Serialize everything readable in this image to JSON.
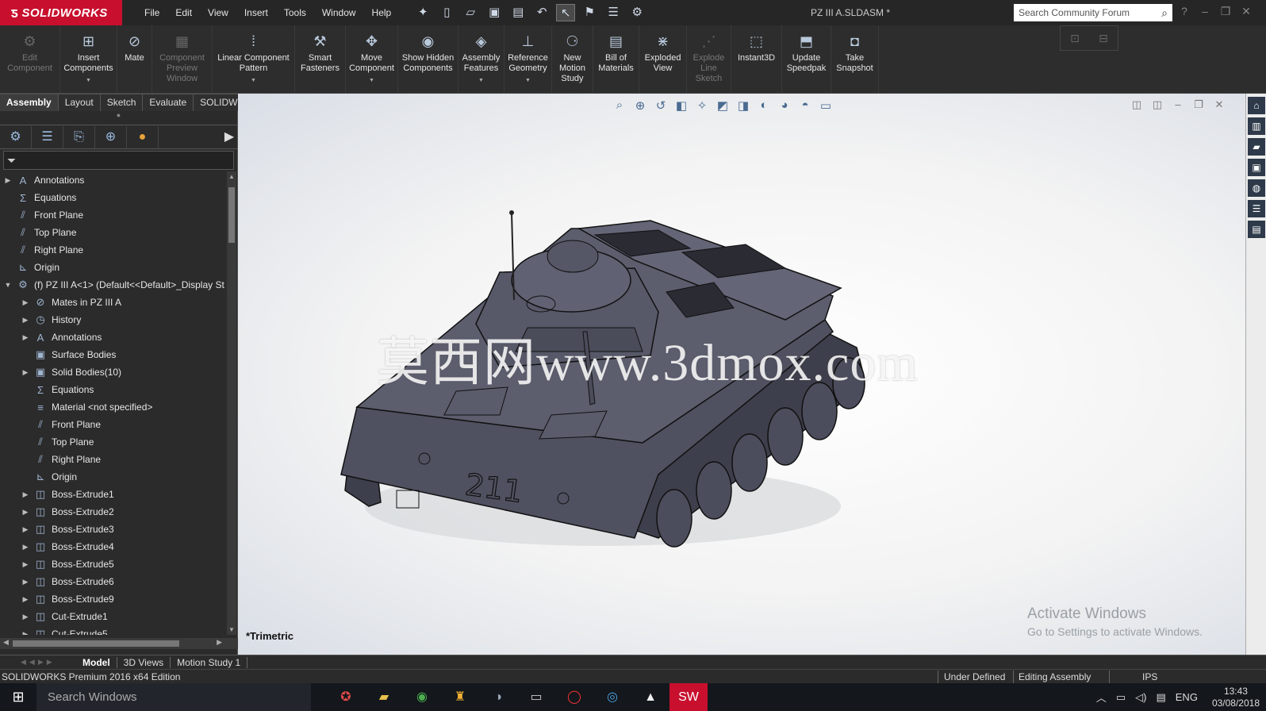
{
  "app": {
    "logo": "SOLIDWORKS",
    "doc_title": "PZ III A.SLDASM *",
    "menus": [
      "File",
      "Edit",
      "View",
      "Insert",
      "Tools",
      "Window",
      "Help"
    ],
    "search_placeholder": "Search Community Forum"
  },
  "commands": [
    {
      "label": "Edit Component",
      "icon": "edit-component-icon",
      "disabled": true
    },
    {
      "label": "Insert Components",
      "icon": "insert-components-icon",
      "disabled": false,
      "dropdown": true
    },
    {
      "label": "Mate",
      "icon": "mate-icon",
      "disabled": false
    },
    {
      "label": "Component Preview Window",
      "icon": "component-preview-icon",
      "disabled": true
    },
    {
      "label": "Linear Component Pattern",
      "icon": "linear-pattern-icon",
      "disabled": false,
      "dropdown": true
    },
    {
      "label": "Smart Fasteners",
      "icon": "smart-fasteners-icon",
      "disabled": false
    },
    {
      "label": "Move Component",
      "icon": "move-component-icon",
      "disabled": false,
      "dropdown": true
    },
    {
      "label": "Show Hidden Components",
      "icon": "show-hidden-icon",
      "disabled": false
    },
    {
      "label": "Assembly Features",
      "icon": "assembly-features-icon",
      "disabled": false,
      "dropdown": true
    },
    {
      "label": "Reference Geometry",
      "icon": "reference-geometry-icon",
      "disabled": false,
      "dropdown": true
    },
    {
      "label": "New Motion Study",
      "icon": "motion-study-icon",
      "disabled": false
    },
    {
      "label": "Bill of Materials",
      "icon": "bill-of-materials-icon",
      "disabled": false
    },
    {
      "label": "Exploded View",
      "icon": "exploded-view-icon",
      "disabled": false
    },
    {
      "label": "Explode Line Sketch",
      "icon": "explode-line-icon",
      "disabled": true
    },
    {
      "label": "Instant3D",
      "icon": "instant3d-icon",
      "disabled": false
    },
    {
      "label": "Update Speedpak",
      "icon": "speedpak-icon",
      "disabled": false
    },
    {
      "label": "Take Snapshot",
      "icon": "snapshot-icon",
      "disabled": false
    }
  ],
  "tabs": [
    "Assembly",
    "Layout",
    "Sketch",
    "Evaluate",
    "SOLIDWORKS Add-Ins"
  ],
  "tree": [
    {
      "label": "Annotations",
      "level": 0,
      "expand": "closed"
    },
    {
      "label": "Equations",
      "level": 0,
      "expand": "none"
    },
    {
      "label": "Front Plane",
      "level": 0,
      "expand": "none"
    },
    {
      "label": "Top Plane",
      "level": 0,
      "expand": "none"
    },
    {
      "label": "Right Plane",
      "level": 0,
      "expand": "none"
    },
    {
      "label": "Origin",
      "level": 0,
      "expand": "none"
    },
    {
      "label": "(f) PZ III A<1> (Default<<Default>_Display St",
      "level": 0,
      "expand": "open"
    },
    {
      "label": "Mates in PZ III A",
      "level": 1,
      "expand": "closed"
    },
    {
      "label": "History",
      "level": 1,
      "expand": "closed"
    },
    {
      "label": "Annotations",
      "level": 1,
      "expand": "closed"
    },
    {
      "label": "Surface Bodies",
      "level": 1,
      "expand": "none"
    },
    {
      "label": "Solid Bodies(10)",
      "level": 1,
      "expand": "closed"
    },
    {
      "label": "Equations",
      "level": 1,
      "expand": "none"
    },
    {
      "label": "Material <not specified>",
      "level": 1,
      "expand": "none"
    },
    {
      "label": "Front Plane",
      "level": 1,
      "expand": "none"
    },
    {
      "label": "Top Plane",
      "level": 1,
      "expand": "none"
    },
    {
      "label": "Right Plane",
      "level": 1,
      "expand": "none"
    },
    {
      "label": "Origin",
      "level": 1,
      "expand": "none"
    },
    {
      "label": "Boss-Extrude1",
      "level": 1,
      "expand": "closed"
    },
    {
      "label": "Boss-Extrude2",
      "level": 1,
      "expand": "closed"
    },
    {
      "label": "Boss-Extrude3",
      "level": 1,
      "expand": "closed"
    },
    {
      "label": "Boss-Extrude4",
      "level": 1,
      "expand": "closed"
    },
    {
      "label": "Boss-Extrude5",
      "level": 1,
      "expand": "closed"
    },
    {
      "label": "Boss-Extrude6",
      "level": 1,
      "expand": "closed"
    },
    {
      "label": "Boss-Extrude9",
      "level": 1,
      "expand": "closed"
    },
    {
      "label": "Cut-Extrude1",
      "level": 1,
      "expand": "closed"
    },
    {
      "label": "Cut-Extrude5",
      "level": 1,
      "expand": "closed"
    }
  ],
  "viewport": {
    "view_name": "*Trimetric",
    "watermark": "莫西网www.3dmox.com",
    "hull_number": "211",
    "activate_title": "Activate Windows",
    "activate_sub": "Go to Settings to activate Windows."
  },
  "bottom_tabs": [
    "Model",
    "3D Views",
    "Motion Study 1"
  ],
  "status": {
    "edition": "SOLIDWORKS Premium 2016 x64 Edition",
    "definition": "Under Defined",
    "mode": "Editing Assembly",
    "units": "IPS"
  },
  "taskbar": {
    "search": "Search Windows",
    "lang": "ENG",
    "time": "13:43",
    "date": "03/08/2018"
  }
}
